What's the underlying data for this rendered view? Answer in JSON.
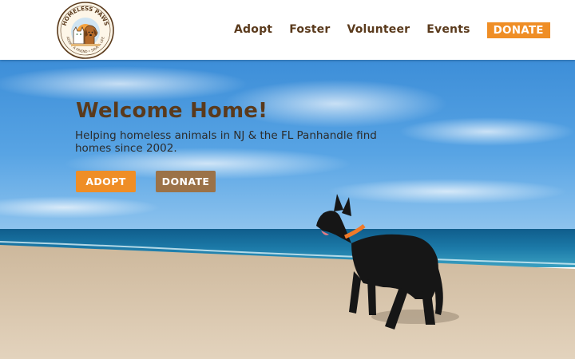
{
  "logo": {
    "alt_text_top": "HOMELESS PAWS",
    "alt_text_bottom": "ADOPT A FRIEND • SAVE A LIFE",
    "icon": "cat-and-dog-logo"
  },
  "nav": {
    "items": [
      {
        "label": "Adopt"
      },
      {
        "label": "Foster"
      },
      {
        "label": "Volunteer"
      },
      {
        "label": "Events"
      }
    ],
    "donate_label": "DONATE"
  },
  "hero": {
    "title": "Welcome Home!",
    "subtitle": "Helping homeless animals in NJ & the FL Panhandle find homes since 2002.",
    "adopt_button": "ADOPT",
    "donate_button": "DONATE",
    "image": "black-dog-on-beach"
  },
  "colors": {
    "brand_brown": "#5a3a1c",
    "accent_orange": "#ef8e26",
    "secondary_brown": "#9b7248"
  }
}
